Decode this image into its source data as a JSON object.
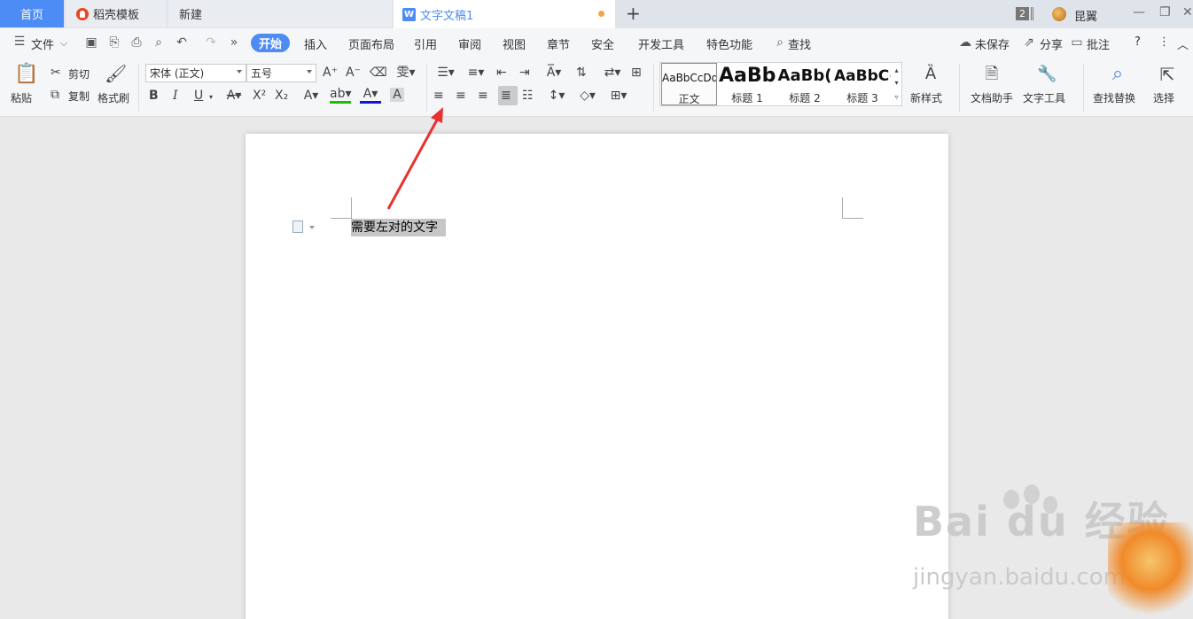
{
  "tabs": {
    "home": "首页",
    "daoke": "稻壳模板",
    "new": "新建",
    "doc": "文字文稿1",
    "add": "+"
  },
  "window": {
    "badge": "2",
    "user": "昆翼",
    "minimize": "—",
    "restore": "❐",
    "close": "✕"
  },
  "menubar": {
    "file": "文件",
    "more": "»",
    "items": [
      "开始",
      "插入",
      "页面布局",
      "引用",
      "审阅",
      "视图",
      "章节",
      "安全",
      "开发工具",
      "特色功能",
      "查找"
    ],
    "unsaved": "未保存",
    "share": "分享",
    "comment": "批注",
    "help": "?",
    "kebab": "⋮",
    "collapse": "︿"
  },
  "ribbon": {
    "paste": "粘贴",
    "cut": "剪切",
    "copy": "复制",
    "format_painter": "格式刷",
    "font_name": "宋体 (正文)",
    "font_size": "五号",
    "bold": "B",
    "italic": "I",
    "underline": "U",
    "styles": [
      {
        "sample": "AaBbCcDd",
        "label": "正文"
      },
      {
        "sample": "AaBb",
        "label": "标题 1"
      },
      {
        "sample": "AaBb(",
        "label": "标题 2"
      },
      {
        "sample": "AaBbC(",
        "label": "标题 3"
      }
    ],
    "new_style": "新样式",
    "doc_assistant": "文档助手",
    "text_tools": "文字工具",
    "find_replace": "查找替换",
    "select": "选择"
  },
  "document": {
    "selected_text": "需要左对的文字"
  },
  "watermark": {
    "brand": "Bai du 经验",
    "url": "jingyan.baidu.com"
  },
  "colors": {
    "accent": "#4d8cf5",
    "arrow": "#e8322f",
    "highlight_green": "#19c000",
    "font_red": "#1414d8"
  }
}
